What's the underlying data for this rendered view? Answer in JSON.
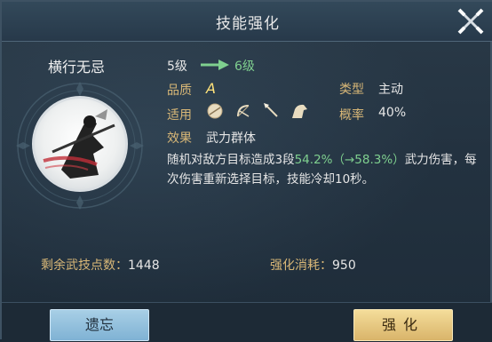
{
  "window": {
    "title": "技能强化"
  },
  "skill": {
    "name": "横行无忌",
    "level_from": "5级",
    "level_to": "6级",
    "quality_label": "品质",
    "quality_value": "A",
    "type_label": "类型",
    "type_value": "主动",
    "applies_label": "适用",
    "applies_icons": [
      "sphere-icon",
      "bow-icon",
      "spear-icon",
      "horse-icon"
    ],
    "chance_label": "概率",
    "chance_value": "40%",
    "effect_label": "效果",
    "effect_value": "武力群体",
    "desc_part1": "随机对敌方目标造成3段",
    "desc_highlight": "54.2%（→58.3%）",
    "desc_part2": "武力伤害，每次伤害重新选择目标，技能冷却10秒。"
  },
  "footer": {
    "remaining_label": "剩余武技点数：",
    "remaining_value": "1448",
    "cost_label": "强化消耗：",
    "cost_value": "950"
  },
  "buttons": {
    "forget": "遗忘",
    "enhance": "强化"
  },
  "colors": {
    "label_gold": "#d8b777",
    "highlight_green": "#7fd08f",
    "forget_blue": "#8fbfdd",
    "enhance_gold": "#e6c47e"
  }
}
